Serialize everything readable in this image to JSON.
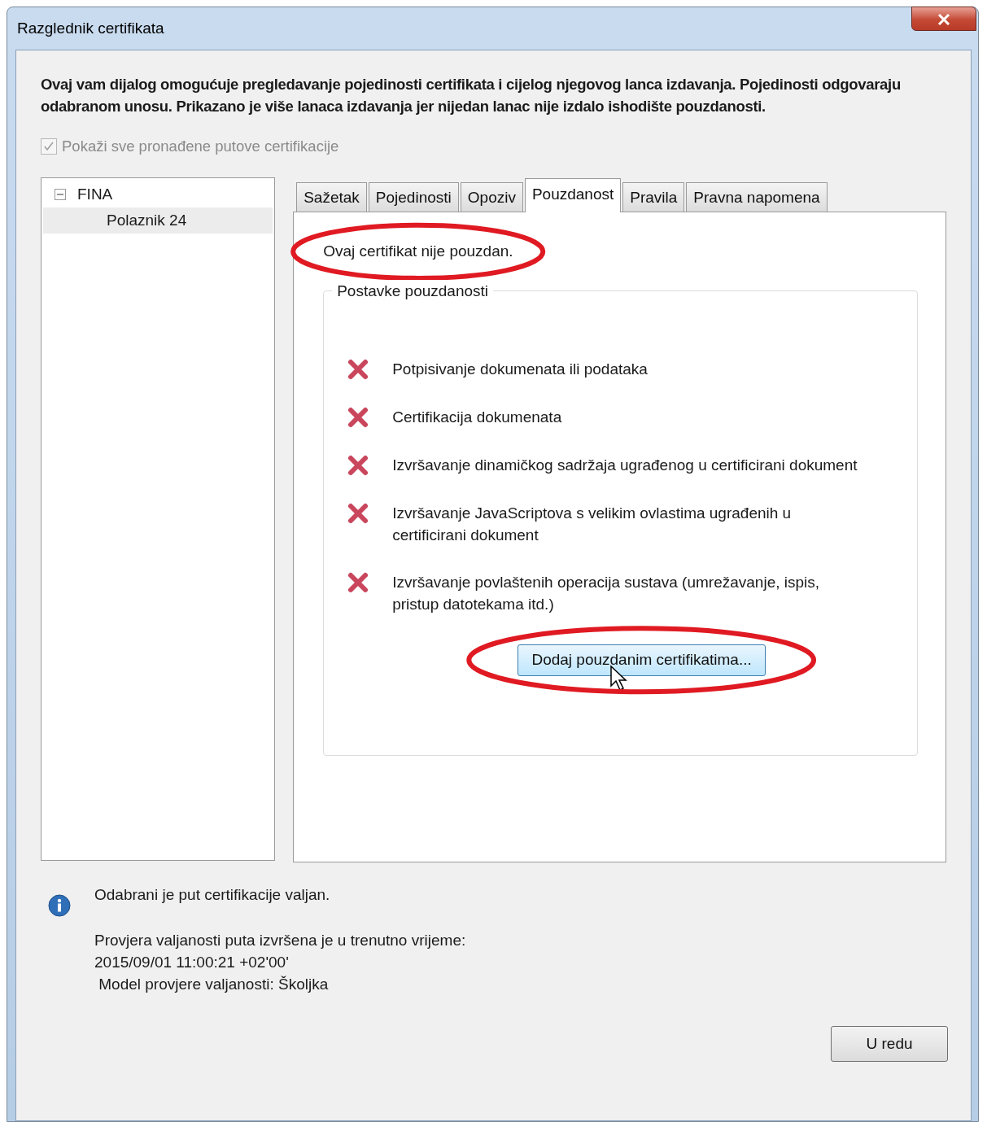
{
  "window": {
    "title": "Razglednik certifikata"
  },
  "intro": "Ovaj vam dijalog omogućuje pregledavanje pojedinosti certifikata i cijelog njegovog lanca izdavanja. Pojedinosti odgovaraju odabranom unosu. Prikazano je više lanaca izdavanja jer nijedan lanac nije izdalo ishodište pouzdanosti.",
  "show_all_paths": {
    "label": "Pokaži sve pronađene putove certifikacije",
    "checked": true,
    "disabled": true
  },
  "tree": [
    {
      "label": "FINA",
      "expanded": true,
      "selected": false,
      "children": [
        {
          "label": "Polaznik 24",
          "selected": true
        }
      ]
    }
  ],
  "tabs": [
    {
      "label": "Sažetak",
      "selected": false
    },
    {
      "label": "Pojedinosti",
      "selected": false
    },
    {
      "label": "Opoziv",
      "selected": false
    },
    {
      "label": "Pouzdanost",
      "selected": true
    },
    {
      "label": "Pravila",
      "selected": false
    },
    {
      "label": "Pravna napomena",
      "selected": false
    }
  ],
  "trust": {
    "status": "Ovaj certifikat nije pouzdan.",
    "status_circled": true,
    "group_title": "Postavke pouzdanosti",
    "items": [
      {
        "label": "Potpisivanje dokumenata ili podataka",
        "allowed": false
      },
      {
        "label": "Certifikacija dokumenata",
        "allowed": false
      },
      {
        "label": "Izvršavanje dinamičkog sadržaja ugrađenog u certificirani dokument",
        "allowed": false
      },
      {
        "label": "Izvršavanje JavaScriptova s velikim ovlastima ugrađenih u certificirani dokument",
        "allowed": false
      },
      {
        "label": "Izvršavanje povlaštenih operacija sustava (umrežavanje, ispis, pristup datotekama itd.)",
        "allowed": false
      }
    ],
    "add_button": {
      "label": "Dodaj pouzdanim certifikatima...",
      "circled": true,
      "hovered": true
    }
  },
  "status": {
    "message": "Odabrani je put certifikacije valjan.",
    "details": [
      "Provjera valjanosti puta izvršena je u trenutno vrijeme:",
      "2015/09/01 11:00:21 +02'00'",
      " Model provjere valjanosti: Školjka"
    ]
  },
  "ok_button": "U redu"
}
